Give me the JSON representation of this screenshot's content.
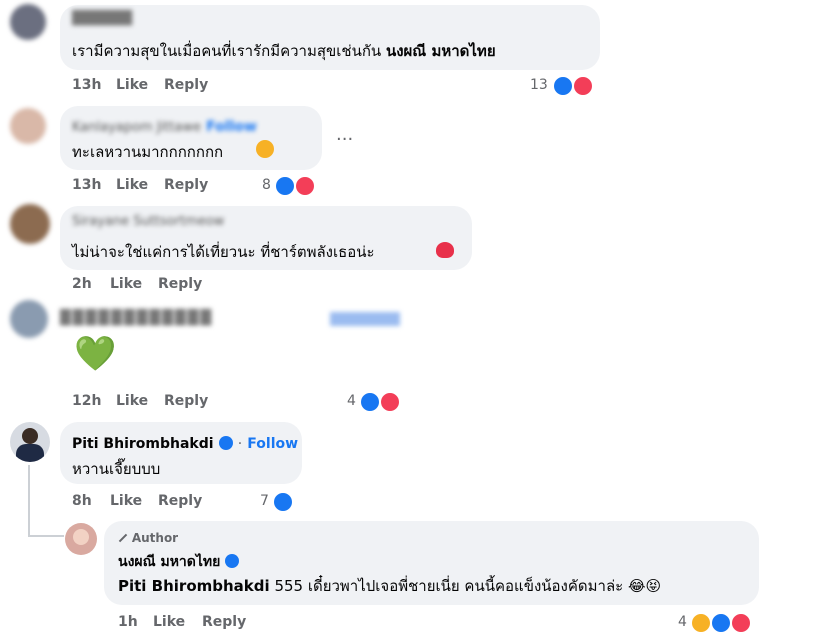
{
  "comments": [
    {
      "name_blur": "██████",
      "text_plain": "เรามีความสุขในเมื่อคนที่เรารักมีความสุขเช่นกัน",
      "text_bold": "นงผณี มหาดไทย",
      "time": "13h",
      "like": "Like",
      "reply": "Reply",
      "count": "13"
    },
    {
      "name_blur": "Kanlayapom Jittawe",
      "follow": "Follow",
      "text": "ทะเลหวานมากกกกกกก",
      "more": "...",
      "time": "13h",
      "like": "Like",
      "reply": "Reply",
      "count": "8"
    },
    {
      "name_blur": "Sirayane Suttsortmeow",
      "text": "ไม่น่าจะใช่แค่การได้เที่ยวนะ ที่ชาร์ตพลังเธอน่ะ",
      "time": "2h",
      "like": "Like",
      "reply": "Reply"
    },
    {
      "name_blur": "████████████",
      "text": "💚",
      "time": "12h",
      "like": "Like",
      "reply": "Reply",
      "count": "4"
    },
    {
      "name": "Piti Bhirombhakdi",
      "follow": "Follow",
      "text": "หวานเจี๊ยบบบ",
      "time": "8h",
      "like": "Like",
      "reply": "Reply",
      "count": "7"
    },
    {
      "badge": "Author",
      "name": "นงผณี มหาดไทย",
      "mention": "Piti Bhirombhakdi",
      "text": "555 เดี๋ยวพาไปเจอพี่ชายเนี่ย คนนี้คอแข็งน้องคัดมาล่ะ 😂😝",
      "time": "1h",
      "like": "Like",
      "reply": "Reply",
      "count": "4"
    }
  ],
  "icons": {
    "like": "like-reaction-icon",
    "love": "love-reaction-icon",
    "haha": "haha-reaction-icon"
  },
  "colors": {
    "bubble": "#f0f2f5",
    "link": "#1877f2",
    "meta": "#65676b"
  }
}
